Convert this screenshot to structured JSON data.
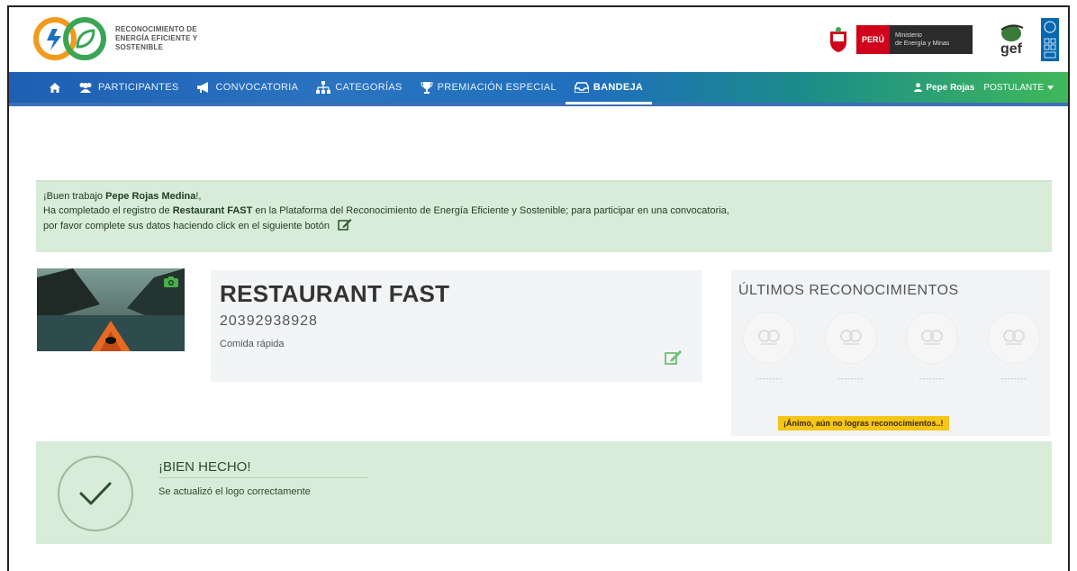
{
  "brand": {
    "logo_text_1": "RECONOCIMIENTO DE",
    "logo_text_2": "ENERGÍA EFICIENTE Y",
    "logo_text_3": "SOSTENIBLE",
    "peru_label": "PERÚ",
    "minem_1": "Ministerio",
    "minem_2": "de Energía y Minas",
    "gef_label": "gef"
  },
  "nav": {
    "home_icon": "home-icon",
    "items": [
      {
        "label": "PARTICIPANTES",
        "icon": "users-icon"
      },
      {
        "label": "CONVOCATORIA",
        "icon": "megaphone-icon"
      },
      {
        "label": "CATEGORÍAS",
        "icon": "sitemap-icon"
      },
      {
        "label": "PREMIACIÓN ESPECIAL",
        "icon": "trophy-icon"
      },
      {
        "label": "BANDEJA",
        "icon": "inbox-icon",
        "active": true
      }
    ],
    "user_name": "Pepe Rojas",
    "role": "POSTULANTE"
  },
  "banner": {
    "greeting_prefix": "¡Buen trabajo ",
    "greeting_name": "Pepe Rojas Medina",
    "greeting_suffix": "!,",
    "line2_prefix": "Ha completado el registro de ",
    "line2_company": "Restaurant FAST",
    "line2_suffix": " en la Plataforma del Reconocimiento de Energía Eficiente y Sostenible; para participar en una convocatoria,",
    "line3": "por favor complete sus datos haciendo click en el siguiente botón"
  },
  "company": {
    "name": "RESTAURANT FAST",
    "ruc": "20392938928",
    "category": "Comida rápida"
  },
  "recognitions": {
    "title": "ÚLTIMOS RECONOCIMIENTOS",
    "placeholder": "--------",
    "badge": "¡Ánimo, aún no logras reconocimientos..!"
  },
  "success": {
    "title": "¡BIEN HECHO!",
    "message": "Se actualizó el logo correctamente"
  },
  "colors": {
    "nav_blue": "#1e5fb3",
    "nav_green": "#3fb85a",
    "banner_green": "#d8ecd9",
    "badge_yellow": "#f5c518"
  }
}
